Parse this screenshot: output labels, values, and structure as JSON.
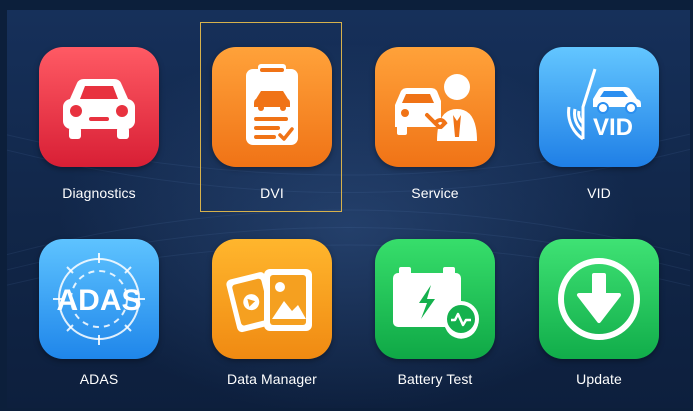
{
  "apps": [
    {
      "label": "Diagnostics",
      "icon": "car-front-icon",
      "colors": [
        "#ff5a64",
        "#d81f35"
      ]
    },
    {
      "label": "DVI",
      "icon": "clipboard-inspection-icon",
      "colors": [
        "#ffa23a",
        "#f07316"
      ],
      "selected": true
    },
    {
      "label": "Service",
      "icon": "car-service-technician-icon",
      "colors": [
        "#ffa23a",
        "#f07316"
      ]
    },
    {
      "label": "VID",
      "icon": "vid-radar-car-icon",
      "colors": [
        "#63c6ff",
        "#1f7fe6"
      ]
    },
    {
      "label": "ADAS",
      "icon": "adas-radar-icon",
      "colors": [
        "#5ec3ff",
        "#1f86ea"
      ]
    },
    {
      "label": "Data Manager",
      "icon": "image-files-icon",
      "colors": [
        "#ffb62d",
        "#f08a12"
      ]
    },
    {
      "label": "Battery Test",
      "icon": "battery-test-icon",
      "colors": [
        "#37de6b",
        "#0fa846"
      ]
    },
    {
      "label": "Update",
      "icon": "download-arrow-icon",
      "colors": [
        "#3fe274",
        "#11ad4a"
      ]
    }
  ],
  "selection_color": "#d6b14c"
}
